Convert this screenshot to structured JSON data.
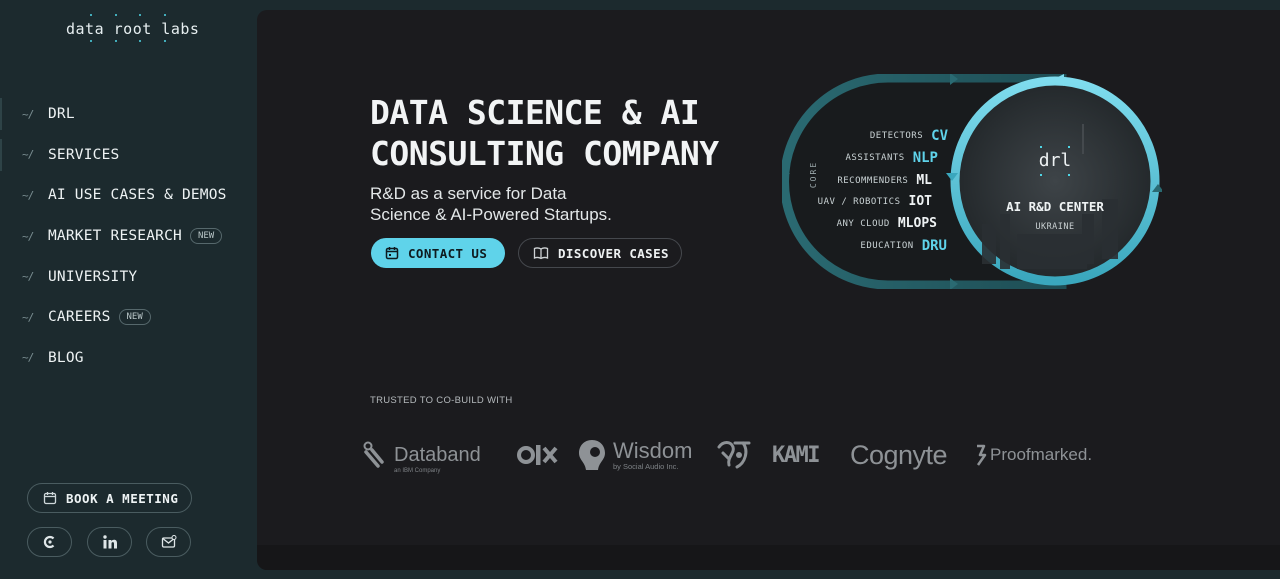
{
  "brand": {
    "logo_text": "data root labs"
  },
  "nav": {
    "items": [
      {
        "label": "DRL",
        "badge": ""
      },
      {
        "label": "SERVICES",
        "badge": ""
      },
      {
        "label": "AI USE CASES & DEMOS",
        "badge": ""
      },
      {
        "label": "MARKET RESEARCH",
        "badge": "NEW"
      },
      {
        "label": "UNIVERSITY",
        "badge": ""
      },
      {
        "label": "CAREERS",
        "badge": "NEW"
      },
      {
        "label": "BLOG",
        "badge": ""
      }
    ],
    "book_meeting": "BOOK A MEETING",
    "socials": [
      "clutch-icon",
      "linkedin-icon",
      "mail-icon"
    ]
  },
  "hero": {
    "title_line1": "DATA SCIENCE & AI",
    "title_line2": "CONSULTING COMPANY",
    "subtitle_line1": "R&D as a service for Data",
    "subtitle_line2": "Science & AI-Powered Startups.",
    "contact_label": "CONTACT US",
    "cases_label": "DISCOVER CASES"
  },
  "diagram": {
    "core_label": "CORE",
    "rows": [
      {
        "key": "DETECTORS",
        "value": "CV",
        "accent": true
      },
      {
        "key": "ASSISTANTS",
        "value": "NLP",
        "accent": true
      },
      {
        "key": "RECOMMENDERS",
        "value": "ML",
        "accent": false
      },
      {
        "key": "UAV / ROBOTICS",
        "value": "IOT",
        "accent": false
      },
      {
        "key": "ANY CLOUD",
        "value": "MLOPS",
        "accent": false
      },
      {
        "key": "EDUCATION",
        "value": "DRU",
        "accent": true
      }
    ],
    "center_logo": "drl",
    "center_title": "AI R&D CENTER",
    "center_subtitle": "UKRAINE"
  },
  "trusted": {
    "label": "TRUSTED TO CO-BUILD WITH",
    "logos": [
      {
        "name": "Databand",
        "sub": "an IBM Company"
      },
      {
        "name": "OLX",
        "sub": ""
      },
      {
        "name": "Wisdom",
        "sub": "by Social Audio Inc."
      },
      {
        "name": "",
        "sub": ""
      },
      {
        "name": "KAMI",
        "sub": ""
      },
      {
        "name": "Cognyte",
        "sub": ""
      },
      {
        "name": "Proofmarked.",
        "sub": ""
      }
    ]
  },
  "colors": {
    "accent": "#5fd3ea",
    "sidebar_bg": "#1c2a2e",
    "main_bg": "#1b1b1e"
  }
}
